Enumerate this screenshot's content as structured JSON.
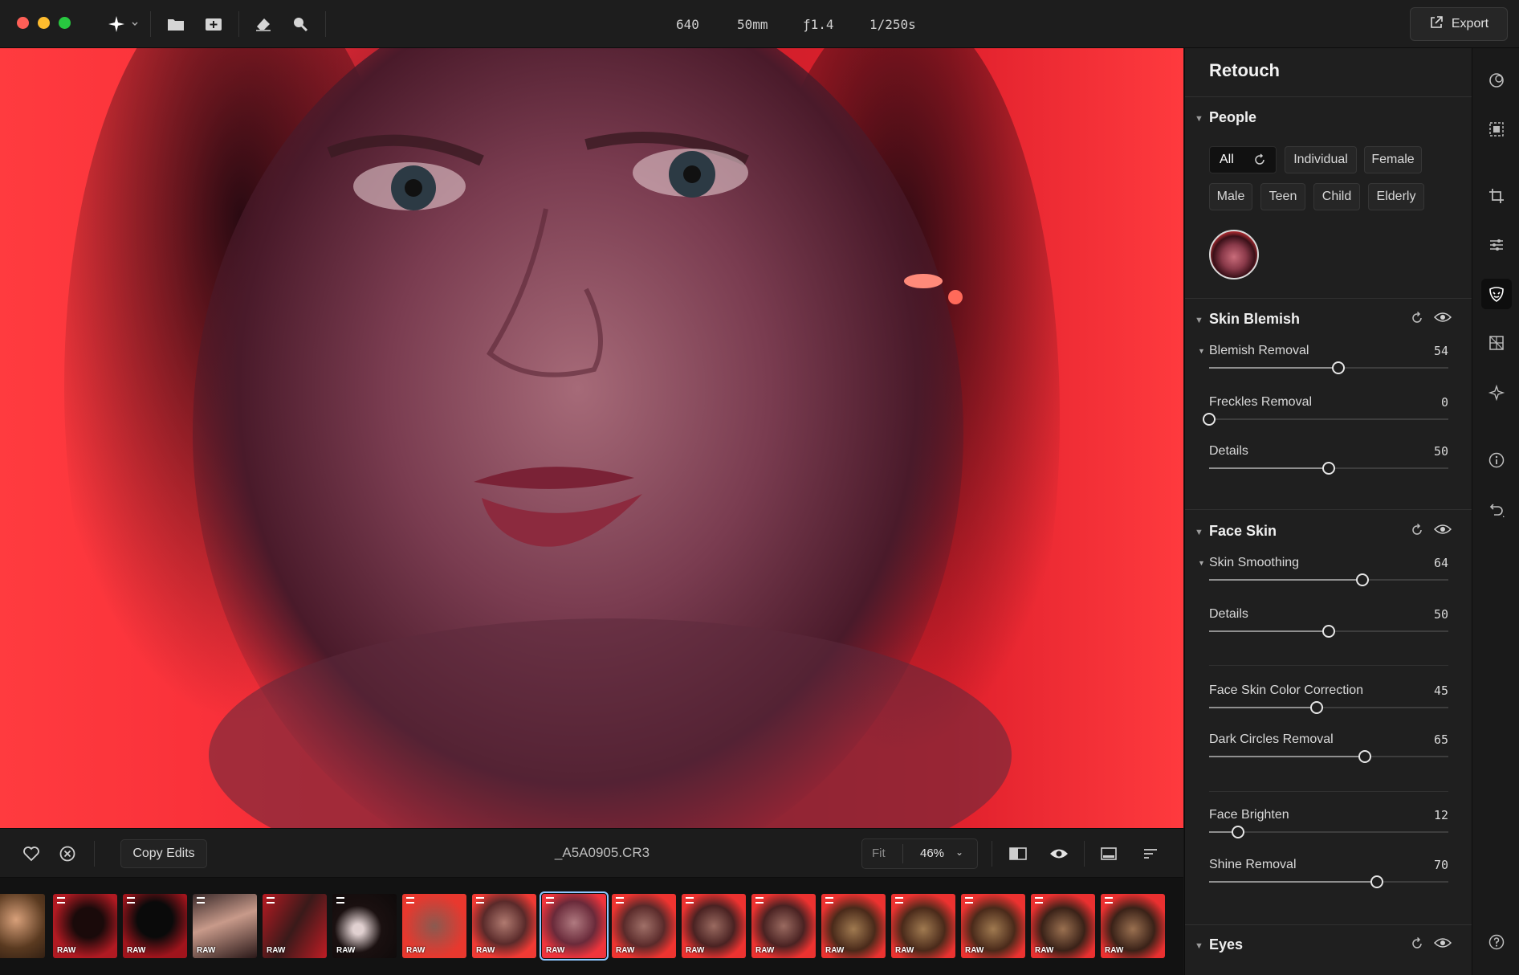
{
  "exif": {
    "iso": "640",
    "focal": "50mm",
    "aperture": "ƒ1.4",
    "shutter": "1/250s"
  },
  "toolbar": {
    "export_label": "Export"
  },
  "bottom": {
    "copy_edits": "Copy Edits",
    "filename": "_A5A0905.CR3",
    "zoom_fit": "Fit",
    "zoom_value": "46%"
  },
  "filmstrip": {
    "raw_label": "RAW"
  },
  "panel": {
    "title": "Retouch",
    "people": {
      "title": "People",
      "chips": [
        "All",
        "Individual",
        "Female",
        "Male",
        "Teen",
        "Child",
        "Elderly"
      ]
    },
    "skin_blemish": {
      "title": "Skin Blemish",
      "sliders": [
        {
          "label": "Blemish Removal",
          "value": "54",
          "level": 54
        },
        {
          "label": "Freckles Removal",
          "value": "0",
          "level": 0
        },
        {
          "label": "Details",
          "value": "50",
          "level": 50
        }
      ]
    },
    "face_skin": {
      "title": "Face Skin",
      "sliders": [
        {
          "label": "Skin Smoothing",
          "value": "64",
          "level": 64
        },
        {
          "label": "Details",
          "value": "50",
          "level": 50
        },
        {
          "label": "Face Skin Color Correction",
          "value": "45",
          "level": 45
        },
        {
          "label": "Dark Circles Removal",
          "value": "65",
          "level": 65
        },
        {
          "label": "Face Brighten",
          "value": "12",
          "level": 12
        },
        {
          "label": "Shine Removal",
          "value": "70",
          "level": 70
        }
      ]
    },
    "eyes": {
      "title": "Eyes"
    }
  },
  "colors": {
    "accent": "#8ec7ff",
    "backdrop_red": "#f52a36",
    "panel_bg": "#1f1f1f"
  }
}
